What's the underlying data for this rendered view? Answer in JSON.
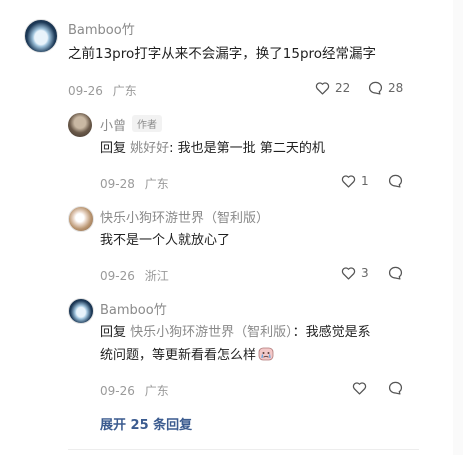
{
  "comments": [
    {
      "user": "Bamboo竹",
      "text": "之前13pro打字从来不会漏字，换了15pro经常漏字",
      "date": "09-26",
      "location": "广东",
      "likes": "22",
      "replies": "28"
    }
  ],
  "replies": [
    {
      "user": "小曾",
      "tag": "作者",
      "prefix": "回复",
      "mention": "姚好好",
      "text": ": 我也是第一批 第二天的机",
      "date": "09-28",
      "location": "广东",
      "likes": "1"
    },
    {
      "user": "快乐小狗环游世界（智利版）",
      "text": "我不是一个人就放心了",
      "date": "09-26",
      "location": "浙江",
      "likes": "3"
    },
    {
      "user": "Bamboo竹",
      "prefix": "回复",
      "mention": "快乐小狗环游世界（智利版）",
      "line1": "：我感觉是系",
      "line2": "统问题，等更新看看怎么样",
      "date": "09-26",
      "location": "广东"
    }
  ],
  "expand_label": "展开 25 条回复",
  "icons": {
    "like": "heart-icon",
    "comment": "comment-bubble-icon",
    "emoji": "crying-face-emoji-icon"
  },
  "colors": {
    "name_gray": "#8a8a8a",
    "expand_blue": "#3b5b8f"
  }
}
